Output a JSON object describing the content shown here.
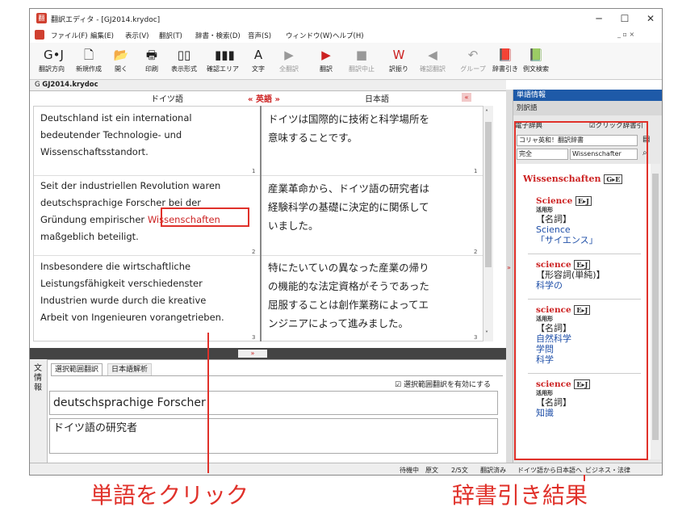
{
  "window": {
    "title": "翻訳エディタ - [GJ2014.krydoc]",
    "app_icon": "翻"
  },
  "menu": [
    "ファイル(F)",
    "編集(E)",
    "表示(V)",
    "翻訳(T)",
    "辞書・検索(D)",
    "音声(S)",
    "ウィンドウ(W)",
    "ヘルプ(H)"
  ],
  "toolbar": [
    {
      "label": "翻訳方向",
      "icon": "G•J"
    },
    {
      "label": "新規作成",
      "icon": "🗋"
    },
    {
      "label": "開く",
      "icon": "📂"
    },
    {
      "label": "印刷",
      "icon": "🖶"
    },
    {
      "label": "表示形式",
      "icon": "▯▯"
    },
    {
      "label": "確認エリア",
      "icon": "▮▮▮"
    },
    {
      "label": "文字",
      "icon": "A"
    },
    {
      "label": "全翻訳",
      "icon": "▶"
    },
    {
      "label": "翻訳",
      "icon": "▶"
    },
    {
      "label": "翻訳中止",
      "icon": "■"
    },
    {
      "label": "訳振り",
      "icon": "W"
    },
    {
      "label": "確認翻訳",
      "icon": "◀"
    },
    {
      "label": "グループ",
      "icon": "↶"
    },
    {
      "label": "辞書引き",
      "icon": "📕"
    },
    {
      "label": "例文検索",
      "icon": "📗"
    }
  ],
  "doc_tab": "GJ2014.krydoc",
  "columns": {
    "source": "ドイツ語",
    "middle": "« 英語 »",
    "target": "日本語"
  },
  "segments": [
    {
      "src": [
        "Deutschland ist ein international",
        "bedeutender Technologie- und",
        "Wissenschaftsstandort."
      ],
      "tgt": [
        "ドイツは国際的に技術と科学場所を",
        "意味することです。"
      ],
      "num": "1"
    },
    {
      "src_pre": [
        "Seit der industriellen Revolution waren",
        "deutschsprachige Forscher bei der"
      ],
      "src_line3_pre": "Gründung empirischer ",
      "src_highlight": "Wissenschaften",
      "src_post": "maßgeblich beteiligt.",
      "tgt": [
        "産業革命から、ドイツ語の研究者は",
        "経験科学の基礎に決定的に関係して",
        "いました。"
      ],
      "num": "2"
    },
    {
      "src": [
        "Insbesondere die wirtschaftliche",
        "Leistungsfähigkeit verschiedenster",
        "Industrien wurde durch die kreative",
        "Arbeit von Ingenieuren vorangetrieben."
      ],
      "tgt": [
        "特にたいていの異なった産業の帰り",
        "の機能的な法定資格がそうであった",
        "屈服することは創作業務によってエ",
        "ンジニアによって進みました。"
      ],
      "num": "3"
    }
  ],
  "side_info_label": "文情報",
  "lower": {
    "tabs": [
      "選択範囲翻訳",
      "日本語解析"
    ],
    "checkbox": "選択範囲翻訳を有効にする",
    "source_text": "deutschsprachige Forscher",
    "result_text": "ドイツ語の研究者"
  },
  "right": {
    "header": "単語情報",
    "sub": "別訳語",
    "dict_label": "電子辞典",
    "click_dict": "クリック辞書引",
    "dict_select": "コリャ英和！翻訳辞書",
    "match_select": "完全",
    "search_value": "Wissenschafter",
    "headword": "Wissenschaften",
    "headword_tag": "G▸E",
    "entries": [
      {
        "word": "Science",
        "tag": "E▸J",
        "form": "活用形",
        "pos": "【名詞】",
        "senses": [
          "Science",
          "「サイエンス」"
        ]
      },
      {
        "word": "science",
        "tag": "E▸J",
        "form": "",
        "pos": "【形容詞(単純)】",
        "senses": [
          "科学の"
        ]
      },
      {
        "word": "science",
        "tag": "E▸J",
        "form": "活用形",
        "pos": "【名詞】",
        "senses": [
          "自然科学",
          "学問",
          "科学"
        ]
      },
      {
        "word": "science",
        "tag": "E▸J",
        "form": "活用形",
        "pos": "【名詞】",
        "senses": [
          "知識"
        ]
      }
    ]
  },
  "status": [
    "待機中",
    "原文",
    "2/5文",
    "翻訳済み",
    "ドイツ語から日本語へ",
    "ビジネス・法律"
  ],
  "captions": {
    "left": "単語をクリック",
    "right": "辞書引き結果"
  },
  "colors": {
    "accent_red": "#e0312a",
    "link_blue": "#1f4fa8"
  }
}
